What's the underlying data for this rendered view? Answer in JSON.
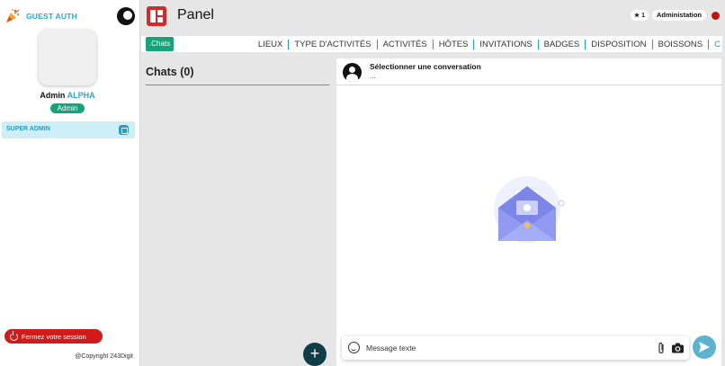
{
  "sidebar": {
    "brand": "GUEST AUTH",
    "user": {
      "first": "Admin",
      "last": "ALPHA",
      "role": "Admin"
    },
    "menu": [
      {
        "label": "SUPER ADMIN",
        "icon": "dashboard-icon"
      }
    ],
    "logout_label": "Fermez votre session",
    "copyright": "@Copyright 243Digit"
  },
  "header": {
    "title": "Panel",
    "star_count": "1",
    "admin_label": "Administation"
  },
  "tabs": {
    "active": ".Chats",
    "items": [
      "LIEUX",
      "TYPE D'ACTIVITÉS",
      "ACTIVITÉS",
      "HÔTES",
      "INVITATIONS",
      "BADGES",
      "DISPOSITION",
      "BOISSONS",
      "C"
    ]
  },
  "chats": {
    "title": "Chats (0)",
    "add_label": "+"
  },
  "conversation": {
    "title": "Sélectionner une conversation",
    "subtitle": "...",
    "input_placeholder": "Message texte"
  },
  "colors": {
    "accent": "#2aa7c9",
    "green": "#17a37a",
    "red": "#d11a1a",
    "dark_teal": "#113d47"
  }
}
